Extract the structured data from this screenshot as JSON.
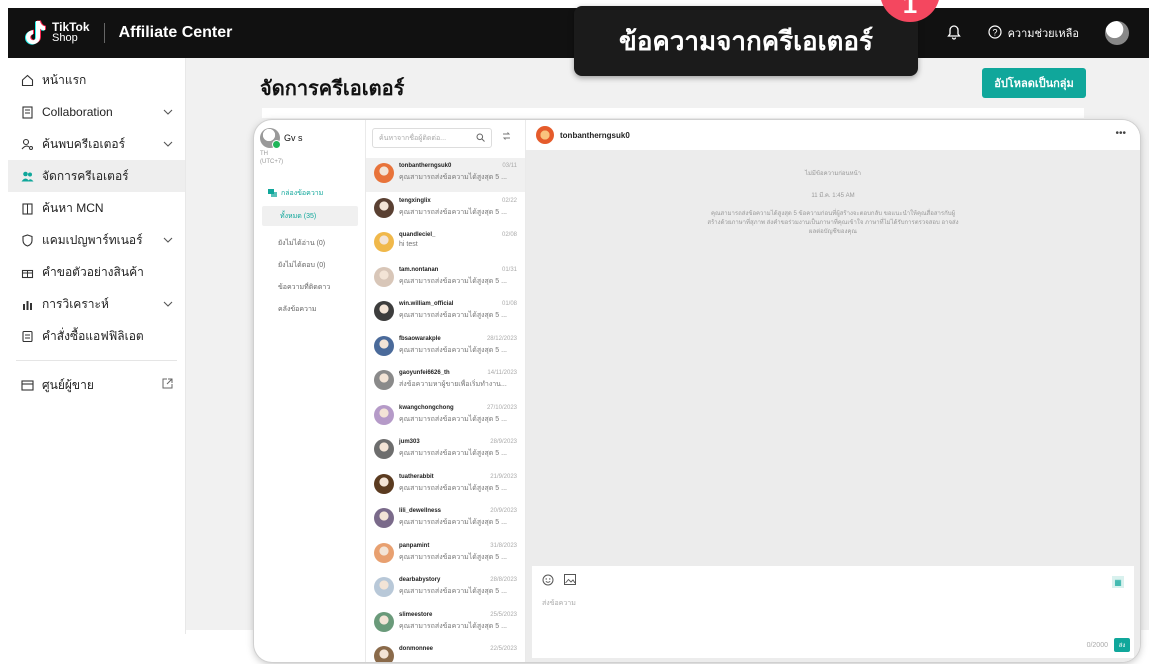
{
  "header": {
    "brand_top": "TikTok",
    "brand_bottom": "Shop",
    "app_title": "Affiliate Center",
    "help_label": "ความช่วยเหลือ"
  },
  "callout": {
    "text": "ข้อความจากครีเอเตอร์",
    "badge": "1"
  },
  "sidebar": {
    "items": [
      {
        "label": "หน้าแรก",
        "icon": "home-icon",
        "chevron": false
      },
      {
        "label": "Collaboration",
        "icon": "document-icon",
        "chevron": true
      },
      {
        "label": "ค้นพบครีเอเตอร์",
        "icon": "person-search-icon",
        "chevron": true
      },
      {
        "label": "จัดการครีเอเตอร์",
        "icon": "people-icon",
        "chevron": false,
        "active": true
      },
      {
        "label": "ค้นหา MCN",
        "icon": "building-icon",
        "chevron": false
      },
      {
        "label": "แคมเปญพาร์ทเนอร์",
        "icon": "shield-icon",
        "chevron": true
      },
      {
        "label": "คำขอตัวอย่างสินค้า",
        "icon": "gift-icon",
        "chevron": false
      },
      {
        "label": "การวิเคราะห์",
        "icon": "chart-icon",
        "chevron": true
      },
      {
        "label": "คำสั่งซื้อแอฟฟิลิเอต",
        "icon": "receipt-icon",
        "chevron": false
      }
    ],
    "seller_center": "ศูนย์ผู้ขาย"
  },
  "main": {
    "page_title": "จัดการครีเอเตอร์",
    "upload_button": "อัปโหลดเป็นกลุ่ม"
  },
  "chat": {
    "me_name": "Gv s",
    "me_region": "TH",
    "me_tz": "(UTC+7)",
    "inbox_label": "กล่องข้อความ",
    "all_label": "ทั้งหมด (35)",
    "filters": [
      "ยังไม่ได้อ่าน (0)",
      "ยังไม่ได้ตอบ (0)",
      "ข้อความที่ติดดาว",
      "คลังข้อความ"
    ],
    "search_placeholder": "ค้นหาจากชื่อผู้ติดต่อ...",
    "conversations": [
      {
        "name": "tonbantherngsuk0",
        "date": "03/11",
        "preview": "คุณสามารถส่งข้อความได้สูงสุด 5 ...",
        "color": "#e8733a"
      },
      {
        "name": "tengxinglix",
        "date": "02/22",
        "preview": "คุณสามารถส่งข้อความได้สูงสุด 5 ...",
        "color": "#5a4032"
      },
      {
        "name": "quandleciel_",
        "date": "02/08",
        "preview": "hi test",
        "color": "#f0b84a"
      },
      {
        "name": "tam.nontanan",
        "date": "01/31",
        "preview": "คุณสามารถส่งข้อความได้สูงสุด 5 ...",
        "color": "#d8c6b8"
      },
      {
        "name": "win.william_official",
        "date": "01/08",
        "preview": "คุณสามารถส่งข้อความได้สูงสุด 5 ...",
        "color": "#3d3d3d"
      },
      {
        "name": "fbsaowarakple",
        "date": "28/12/2023",
        "preview": "คุณสามารถส่งข้อความได้สูงสุด 5 ...",
        "color": "#4a6a9a"
      },
      {
        "name": "gaoyunfei6626_th",
        "date": "14/11/2023",
        "preview": "ส่งข้อความหาผู้ขายเพื่อเริ่มทำงาน...",
        "color": "#8a8a8a"
      },
      {
        "name": "kwangchongchong",
        "date": "27/10/2023",
        "preview": "คุณสามารถส่งข้อความได้สูงสุด 5 ...",
        "color": "#b59ac8"
      },
      {
        "name": "jum303",
        "date": "28/9/2023",
        "preview": "คุณสามารถส่งข้อความได้สูงสุด 5 ...",
        "color": "#6d6d6d"
      },
      {
        "name": "tuatherabbit",
        "date": "21/9/2023",
        "preview": "คุณสามารถส่งข้อความได้สูงสุด 5 ...",
        "color": "#5b3b20"
      },
      {
        "name": "lili_dewellness",
        "date": "20/9/2023",
        "preview": "คุณสามารถส่งข้อความได้สูงสุด 5 ...",
        "color": "#7a6a8a"
      },
      {
        "name": "panpamint",
        "date": "31/8/2023",
        "preview": "คุณสามารถส่งข้อความได้สูงสุด 5 ...",
        "color": "#e8a070"
      },
      {
        "name": "dearbabystory",
        "date": "28/8/2023",
        "preview": "คุณสามารถส่งข้อความได้สูงสุด 5 ...",
        "color": "#b8c8d8"
      },
      {
        "name": "slimeestore",
        "date": "25/5/2023",
        "preview": "คุณสามารถส่งข้อความได้สูงสุด 5 ...",
        "color": "#6a9a7a"
      },
      {
        "name": "donmonnee",
        "date": "22/5/2023",
        "preview": "",
        "color": "#8a6a4a"
      }
    ],
    "active_name": "tonbantherngsuk0",
    "sys_top": "ไม่มีข้อความก่อนหน้า",
    "sys_time": "11 มี.ค. 1:45 AM",
    "sys_notice": "คุณสามารถส่งข้อความได้สูงสุด 5 ข้อความก่อนที่ผู้สร้างจะตอบกลับ ขอแนะนำให้คุณสื่อสารกับผู้สร้างด้วยภาษาที่สุภาพ ส่งคำขอร่วมงานเป็นภาษาที่คุณเข้าใจ ภาษาที่ไม่ได้รับการตรวจสอบ อาจส่งผลต่อบัญชีของคุณ",
    "composer_placeholder": "ส่งข้อความ",
    "char_count": "0/2000",
    "send_label": "ส่ง"
  }
}
